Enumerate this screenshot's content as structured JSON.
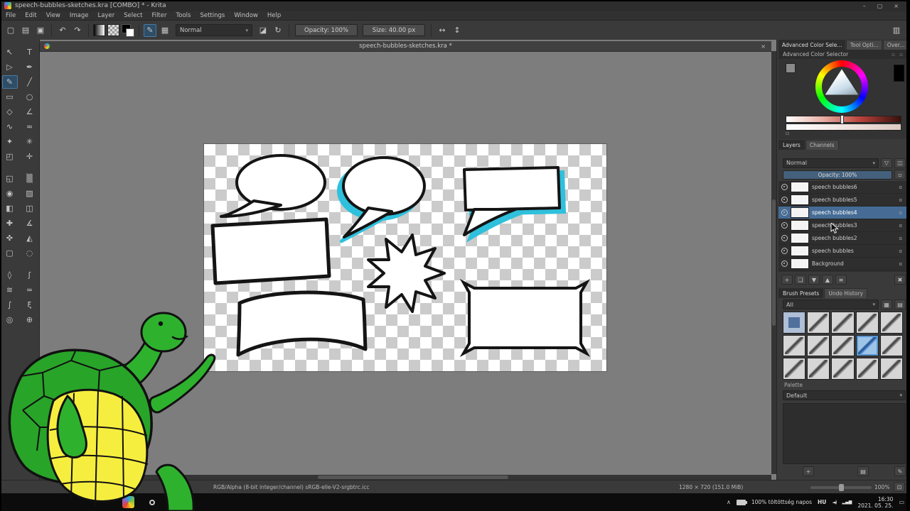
{
  "window": {
    "title": "speech-bubbles-sketches.kra [COMBO] * - Krita"
  },
  "menu": {
    "items": [
      "File",
      "Edit",
      "View",
      "Image",
      "Layer",
      "Select",
      "Filter",
      "Tools",
      "Settings",
      "Window",
      "Help"
    ]
  },
  "toolbar": {
    "items": [
      {
        "type": "btn",
        "name": "new-document-button",
        "glyph": "▢"
      },
      {
        "type": "btn",
        "name": "open-document-button",
        "glyph": "▤"
      },
      {
        "type": "btn",
        "name": "save-document-button",
        "glyph": "▣"
      },
      {
        "type": "sep"
      },
      {
        "type": "btn",
        "name": "undo-button",
        "glyph": "↶"
      },
      {
        "type": "btn",
        "name": "redo-button",
        "glyph": "↷"
      },
      {
        "type": "sep"
      },
      {
        "type": "swatch",
        "name": "gradient-chooser",
        "style": "gradient"
      },
      {
        "type": "swatch",
        "name": "pattern-chooser",
        "style": "pattern"
      },
      {
        "type": "swatch",
        "name": "foreground-background-colors",
        "style": "fgbg"
      },
      {
        "type": "sep"
      },
      {
        "type": "btn",
        "name": "edit-brush-settings-button",
        "glyph": "✎",
        "checked": true
      },
      {
        "type": "btn",
        "name": "brush-presets-chooser-button",
        "glyph": "▦"
      },
      {
        "type": "dropdown",
        "name": "blending-mode-select",
        "label": "Normal"
      },
      {
        "type": "btn",
        "name": "eraser-mode-button",
        "glyph": "◪"
      },
      {
        "type": "btn",
        "name": "reload-preset-button",
        "glyph": "↻"
      },
      {
        "type": "sep"
      },
      {
        "type": "slider",
        "name": "opacity-slider",
        "label": "Opacity: 100%"
      },
      {
        "type": "slider",
        "name": "size-slider",
        "label": "Size: 40.00 px"
      },
      {
        "type": "sep"
      },
      {
        "type": "btn",
        "name": "mirror-horizontal-button",
        "glyph": "↔"
      },
      {
        "type": "btn",
        "name": "mirror-vertical-button",
        "glyph": "↕"
      }
    ],
    "workspace_button_glyph": "▥"
  },
  "toolbox": {
    "groups": [
      [
        {
          "name": "select-shapes-tool",
          "glyph": "↖"
        },
        {
          "name": "text-tool",
          "glyph": "T"
        },
        {
          "name": "edit-shapes-tool",
          "glyph": "▷"
        },
        {
          "name": "calligraphy-tool",
          "glyph": "✒"
        },
        {
          "name": "freehand-brush-tool",
          "glyph": "✎",
          "active": true
        },
        {
          "name": "line-tool",
          "glyph": "╱"
        },
        {
          "name": "rectangle-tool",
          "glyph": "▭"
        },
        {
          "name": "ellipse-tool",
          "glyph": "○"
        },
        {
          "name": "polygon-tool",
          "glyph": "◇"
        },
        {
          "name": "polyline-tool",
          "glyph": "∠"
        },
        {
          "name": "bezier-curve-tool",
          "glyph": "∿"
        },
        {
          "name": "freehand-path-tool",
          "glyph": "≈"
        },
        {
          "name": "dynamic-brush-tool",
          "glyph": "✦"
        },
        {
          "name": "multibrush-tool",
          "glyph": "✳"
        },
        {
          "name": "transform-tool",
          "glyph": "◰"
        },
        {
          "name": "move-tool",
          "glyph": "✛"
        }
      ],
      [
        {
          "name": "crop-tool",
          "glyph": "◱"
        },
        {
          "name": "gradient-tool",
          "glyph": "▒"
        },
        {
          "name": "color-sampler-tool",
          "glyph": "◉"
        },
        {
          "name": "pattern-edit-tool",
          "glyph": "▨"
        },
        {
          "name": "fill-tool",
          "glyph": "◧"
        },
        {
          "name": "enclose-fill-tool",
          "glyph": "◫"
        },
        {
          "name": "assistants-tool",
          "glyph": "✚"
        },
        {
          "name": "measure-tool",
          "glyph": "∡"
        },
        {
          "name": "smart-patch-tool",
          "glyph": "✜"
        },
        {
          "name": "colorize-mask-tool",
          "glyph": "◭"
        },
        {
          "name": "rectangular-selection-tool",
          "glyph": "▢"
        },
        {
          "name": "elliptical-selection-tool",
          "glyph": "◌"
        }
      ],
      [
        {
          "name": "polygonal-selection-tool",
          "glyph": "◊"
        },
        {
          "name": "freehand-selection-tool",
          "glyph": "ʃ"
        },
        {
          "name": "contiguous-selection-tool",
          "glyph": "≋"
        },
        {
          "name": "similar-color-selection-tool",
          "glyph": "≃"
        },
        {
          "name": "bezier-selection-tool",
          "glyph": "∫"
        },
        {
          "name": "magnetic-selection-tool",
          "glyph": "ξ"
        },
        {
          "name": "zoom-tool",
          "glyph": "◎"
        },
        {
          "name": "pan-tool",
          "glyph": "⊕"
        }
      ]
    ]
  },
  "document": {
    "tab_title": "speech-bubbles-sketches.kra *"
  },
  "color_docker": {
    "tabs": [
      {
        "label": "Advanced Color Sele...",
        "selected": true
      },
      {
        "label": "Tool Opti...",
        "selected": false
      },
      {
        "label": "Over...",
        "selected": false
      }
    ],
    "header": "Advanced Color Selector"
  },
  "layers_docker": {
    "tabs": [
      {
        "label": "Layers",
        "selected": true
      },
      {
        "label": "Channels",
        "selected": false
      }
    ],
    "blending_mode": "Normal",
    "opacity_label": "Opacity: 100%",
    "selected_index": 2,
    "items": [
      {
        "name": "speech bubbles6"
      },
      {
        "name": "speech bubbles5"
      },
      {
        "name": "speech bubbles4"
      },
      {
        "name": "speech bubbles3"
      },
      {
        "name": "speech bubbles2"
      },
      {
        "name": "speech bubbles"
      },
      {
        "name": "Background"
      }
    ],
    "buttons": [
      {
        "name": "add-layer-button",
        "glyph": "+"
      },
      {
        "name": "duplicate-layer-button",
        "glyph": "❏"
      },
      {
        "name": "move-layer-down-button",
        "glyph": "▼"
      },
      {
        "name": "move-layer-up-button",
        "glyph": "▲"
      },
      {
        "name": "layer-properties-button",
        "glyph": "≡"
      },
      {
        "name": "delete-layer-button",
        "glyph": "✖",
        "right": true
      }
    ]
  },
  "brush_docker": {
    "tabs": [
      {
        "label": "Brush Presets",
        "selected": true
      },
      {
        "label": "Undo History",
        "selected": false
      }
    ],
    "tag_filter": "All",
    "preset_count": 15,
    "selected_index": 8
  },
  "palette_docker": {
    "label": "Palette",
    "value": "Default"
  },
  "status_bar": {
    "profile": "RGB/Alpha (8-bit integer/channel) sRGB-elle-V2-srgbtrc.icc",
    "dimensions": "1280 × 720 (151.0 MiB)",
    "zoom": "100%"
  },
  "taskbar": {
    "battery_text": "100% töltöttség napos",
    "language": "HU",
    "time": "16:30",
    "date": "2021. 05. 25."
  },
  "icons": {
    "dropdown_arrow": "▾",
    "minimize": "–",
    "maximize": "▢",
    "close": "×",
    "doc_close": "×",
    "docker_dots": "▫ ▫",
    "mini_square": "▫",
    "layer_filter": "▽",
    "layer_view": "◫",
    "layer_lock": "▫",
    "alpha_lock": "α",
    "tag_grid": "▦",
    "tag_list": "▤",
    "palette_add": "+",
    "palette_view": "▤",
    "palette_edit": "✎",
    "zoom_fit": "⊡",
    "tray_chevron": "∧",
    "volume": "◄)",
    "network": "▂▄▆",
    "notification": "▭"
  },
  "colors": {
    "accent_selection": "#466c96",
    "tool_active": "#2e4d66",
    "canvas_background": "#7d7d7d",
    "checker": "#cbcbcb",
    "bubble_ink": "#141414",
    "bubble_shadow_cyan": "#2fc0dc",
    "turtle_green": "#2eb22e",
    "turtle_shell_green": "#28a428",
    "turtle_yellow": "#f6ee3f"
  }
}
